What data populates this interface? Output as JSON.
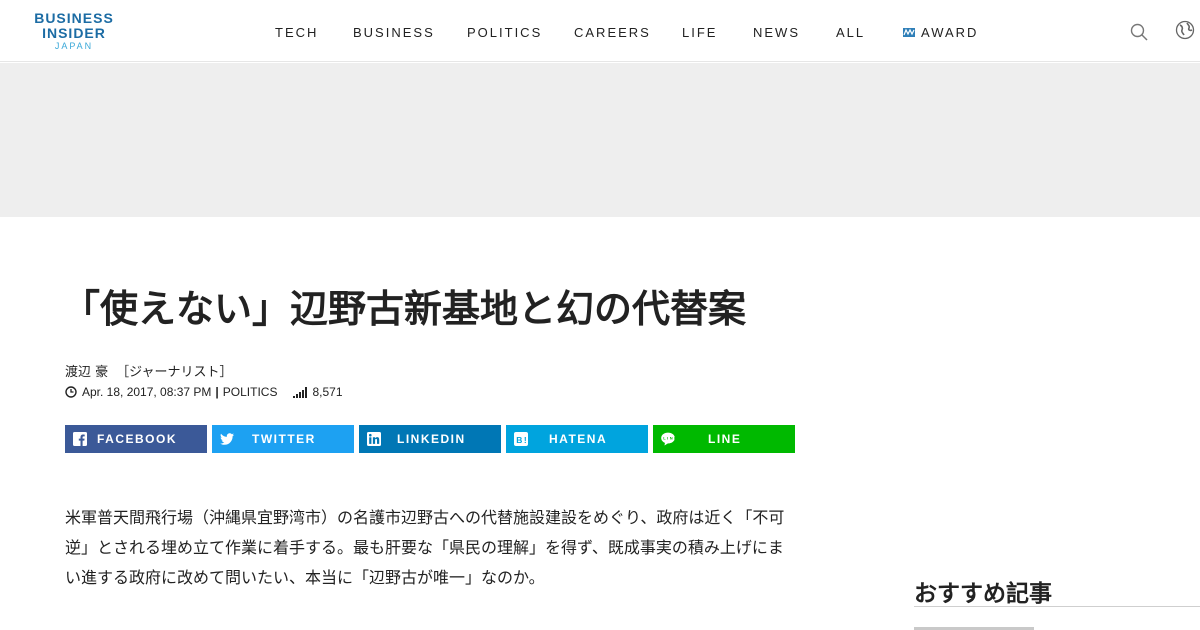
{
  "brand": {
    "line1": "BUSINESS",
    "line2": "INSIDER",
    "sub": "JAPAN",
    "primary_color": "#1c6ca4",
    "secondary_color": "#3aa8d8"
  },
  "nav": {
    "items": [
      {
        "label": "TECH"
      },
      {
        "label": "BUSINESS"
      },
      {
        "label": "POLITICS"
      },
      {
        "label": "CAREERS"
      },
      {
        "label": "LIFE"
      },
      {
        "label": "NEWS"
      },
      {
        "label": "ALL"
      },
      {
        "label": "AWARD",
        "icon": "award-icon"
      }
    ],
    "right_icons": [
      "search-icon",
      "globe-icon"
    ]
  },
  "article": {
    "title": "「使えない」辺野古新基地と幻の代替案",
    "author": "渡辺 豪",
    "author_role": "［ジャーナリスト］",
    "date": "Apr. 18, 2017, 08:37 PM",
    "category": "POLITICS",
    "views": "8,571",
    "lead": "米軍普天間飛行場（沖縄県宜野湾市）の名護市辺野古への代替施設建設をめぐり、政府は近く「不可逆」とされる埋め立て作業に着手する。最も肝要な「県民の理解」を得ず、既成事実の積み上げにまい進する政府に改めて問いたい、本当に「辺野古が唯一」なのか。"
  },
  "share": {
    "facebook": {
      "label": "FACEBOOK",
      "color": "#3b5998"
    },
    "twitter": {
      "label": "TWITTER",
      "color": "#1da1f2"
    },
    "linkedin": {
      "label": "LINKEDIN",
      "color": "#0077b5"
    },
    "hatena": {
      "label": "HATENA",
      "color": "#00a4de"
    },
    "line": {
      "label": "LINE",
      "color": "#00b900"
    }
  },
  "sidebar": {
    "heading": "おすすめ記事"
  }
}
